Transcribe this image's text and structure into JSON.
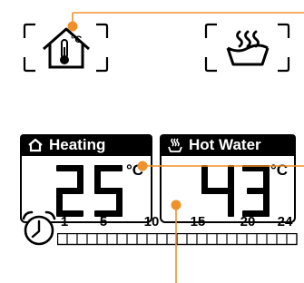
{
  "icons": {
    "house_thermometer": "house-thermometer-icon",
    "hot_water": "hot-water-icon",
    "clock": "clock-icon",
    "house_outline": "house-icon",
    "steam": "steam-icon"
  },
  "house_icon_unit": "°C",
  "heating": {
    "label": "Heating",
    "value": "25",
    "unit": "°C"
  },
  "hot_water": {
    "label": "Hot Water",
    "value": "43",
    "unit": "°C"
  },
  "timeline": {
    "labels": [
      "1",
      "5",
      "10",
      "15",
      "20",
      "24"
    ],
    "segments": 24
  },
  "colors": {
    "callout": "#f0902a",
    "lcd": "#000000",
    "background": "#ffffff"
  }
}
